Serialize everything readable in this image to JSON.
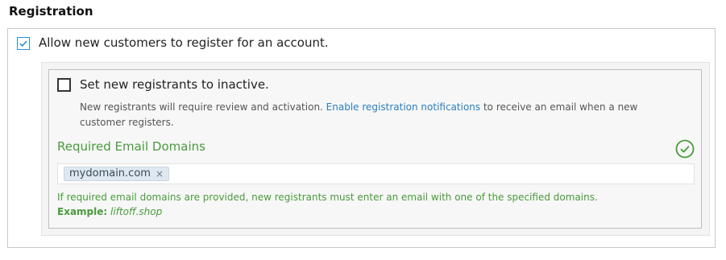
{
  "section": {
    "title": "Registration"
  },
  "allow_registration": {
    "label": "Allow new customers to register for an account.",
    "checked": true
  },
  "inactive": {
    "label": "Set new registrants to inactive.",
    "checked": false,
    "help_before": "New registrants will require review and activation. ",
    "help_link": "Enable registration notifications",
    "help_after": " to receive an email when a new customer registers."
  },
  "email_domains": {
    "label": "Required Email Domains",
    "tags": [
      "mydomain.com"
    ],
    "tag_remove": "×",
    "help": "If required email domains are provided, new registrants must enter an email with one of the specified domains.",
    "example_label": "Example:",
    "example_value": "liftoff.shop"
  },
  "colors": {
    "accent_blue": "#2b8fd6",
    "success_green": "#4a9a3d",
    "link_blue": "#2a7fc1"
  },
  "icons": {
    "allow_checkbox": "checkmark-icon",
    "valid": "check-circle-icon"
  }
}
